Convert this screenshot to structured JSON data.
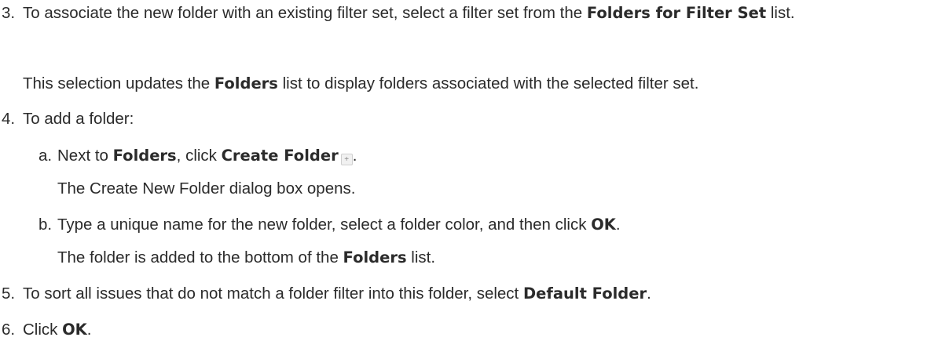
{
  "steps": {
    "s3": {
      "num": "3.",
      "pre": "To associate the new folder with an existing filter set, select a filter set from the ",
      "bold": "Folders for Filter Set",
      "post": " list.",
      "note_pre": "This selection updates the ",
      "note_bold": "Folders",
      "note_post": " list to display folders associated with the selected filter set."
    },
    "s4": {
      "num": "4.",
      "text": "To add a folder:",
      "a": {
        "num": "a.",
        "pre": "Next to ",
        "bold1": "Folders",
        "mid": ", click ",
        "bold2": "Create Folder",
        "post": ".",
        "icon_glyph": "+",
        "note": "The Create New Folder dialog box opens."
      },
      "b": {
        "num": "b.",
        "pre": "Type a unique name for the new folder, select a folder color, and then click ",
        "bold": "OK",
        "post": ".",
        "note_pre": "The folder is added to the bottom of the ",
        "note_bold": "Folders",
        "note_post": " list."
      }
    },
    "s5": {
      "num": "5.",
      "pre": "To sort all issues that do not match a folder filter into this folder, select ",
      "bold": "Default Folder",
      "post": "."
    },
    "s6": {
      "num": "6.",
      "pre": "Click ",
      "bold": "OK",
      "post": "."
    }
  }
}
